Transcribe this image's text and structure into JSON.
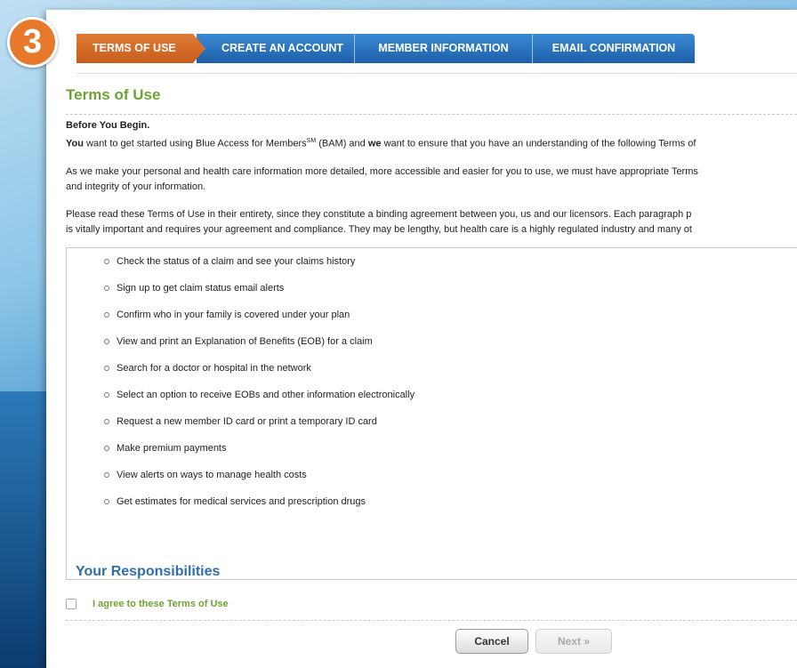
{
  "step_number": "3",
  "tabs": [
    {
      "label": "TERMS OF USE"
    },
    {
      "label": "CREATE AN ACCOUNT"
    },
    {
      "label": "MEMBER INFORMATION"
    },
    {
      "label": "EMAIL CONFIRMATION"
    }
  ],
  "page_title": "Terms of Use",
  "intro": {
    "heading": "Before You Begin.",
    "p1_you": "You",
    "p1_a": " want to get started using Blue Access for Members",
    "p1_sm": "SM",
    "p1_b": " (BAM) and ",
    "p1_we": "we",
    "p1_c": " want to ensure that you have an understanding of the following Terms of",
    "p2_line1": "As we make your personal and health care information more detailed, more accessible and easier for you to use, we must have appropriate Terms",
    "p2_line2": "and integrity of your information.",
    "p3_line1": "Please read these Terms of Use in their entirety, since they constitute a binding agreement between you, us and our licensors. Each paragraph p",
    "p3_line2": "is vitally important and requires your agreement and compliance. They may be lengthy, but health care is a highly regulated industry and many ot"
  },
  "features": [
    "Check the status of a claim and see your claims history",
    "Sign up to get claim status email alerts",
    "Confirm who in your family is covered under your plan",
    "View and print an Explanation of Benefits (EOB) for a claim",
    "Search for a doctor or hospital in the network",
    "Select an option to receive EOBs and other information electronically",
    "Request a new member ID card or print a temporary ID card",
    "Make premium payments",
    "View alerts on ways to manage health costs",
    "Get estimates for medical services and prescription drugs"
  ],
  "responsibilities_title": "Your Responsibilities",
  "agree_label": "I agree to these Terms of Use",
  "agree_checked": false,
  "buttons": {
    "cancel": "Cancel",
    "next": "Next »"
  },
  "colors": {
    "active_tab": "#d26a26",
    "tab": "#2a72bd",
    "title_green": "#6fa234",
    "responsibilities_blue": "#2f6db5",
    "badge_orange": "#e8792a"
  }
}
